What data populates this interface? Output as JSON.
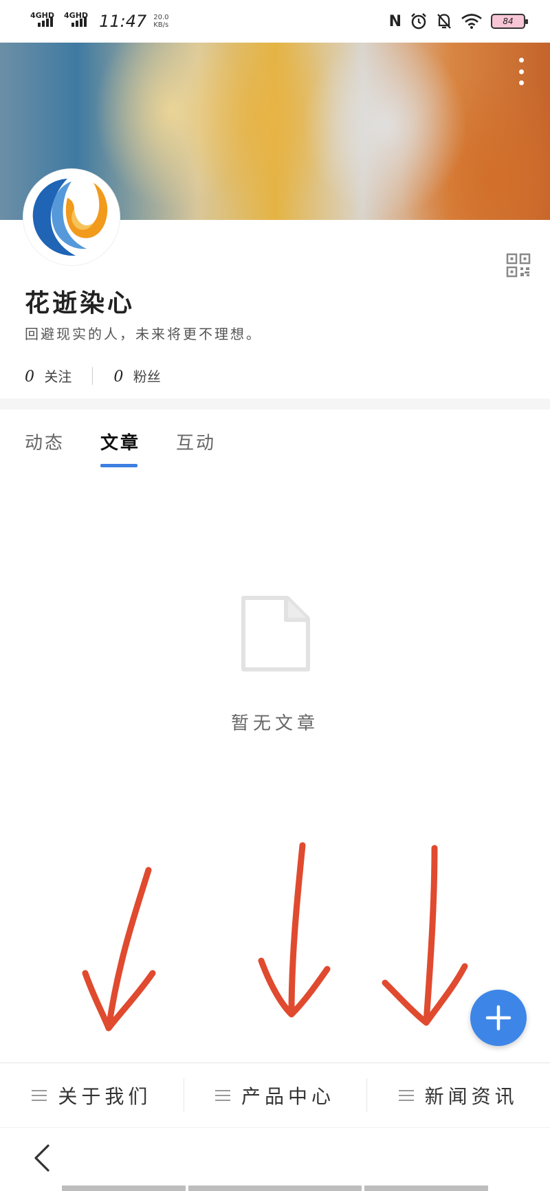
{
  "status_bar": {
    "network1": "4GHD",
    "network2": "4GHD",
    "time": "11:47",
    "speed_value": "20.0",
    "speed_unit": "KB/s",
    "nfc": "N",
    "battery": "84"
  },
  "profile": {
    "username": "花逝染心",
    "bio": "回避现实的人，未来将更不理想。",
    "following_count": "0",
    "following_label": "关注",
    "followers_count": "0",
    "followers_label": "粉丝"
  },
  "tabs": [
    {
      "label": "动态",
      "active": false
    },
    {
      "label": "文章",
      "active": true
    },
    {
      "label": "互动",
      "active": false
    }
  ],
  "empty_state": {
    "text": "暂无文章",
    "icon": "document-icon"
  },
  "bottom_menu": [
    {
      "label": "关于我们",
      "icon": "menu-lines-icon"
    },
    {
      "label": "产品中心",
      "icon": "menu-lines-icon"
    },
    {
      "label": "新闻资讯",
      "icon": "menu-lines-icon"
    }
  ],
  "colors": {
    "accent": "#3d7fe0",
    "fab": "#3d86e8",
    "annotation_arrow": "#e04a2f"
  },
  "icons": {
    "more": "more-vertical-icon",
    "qr": "qr-code-icon",
    "fab": "plus-icon",
    "back": "back-chevron-icon"
  }
}
